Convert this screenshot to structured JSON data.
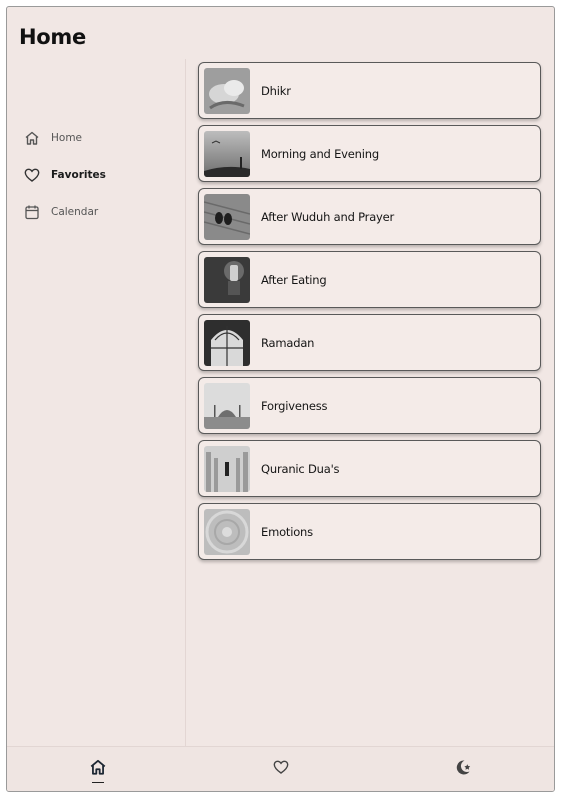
{
  "header": {
    "title": "Home"
  },
  "sidebar": {
    "items": [
      {
        "label": "Home",
        "icon": "home-icon"
      },
      {
        "label": "Favorites",
        "icon": "heart-icon",
        "active": true
      },
      {
        "label": "Calendar",
        "icon": "calendar-icon"
      }
    ]
  },
  "categories": [
    {
      "label": "Dhikr",
      "image": "hands-image"
    },
    {
      "label": "Morning and Evening",
      "image": "sunset-mosque-image"
    },
    {
      "label": "After Wuduh and Prayer",
      "image": "prayer-mat-image"
    },
    {
      "label": "After Eating",
      "image": "lantern-image"
    },
    {
      "label": "Ramadan",
      "image": "arched-window-image"
    },
    {
      "label": "Forgiveness",
      "image": "mosque-skyline-image"
    },
    {
      "label": "Quranic Dua's",
      "image": "corridor-image"
    },
    {
      "label": "Emotions",
      "image": "dome-ceiling-image"
    }
  ],
  "bottom_nav": {
    "tabs": [
      {
        "icon": "home-icon",
        "active": true
      },
      {
        "icon": "heart-icon"
      },
      {
        "icon": "crescent-star-icon"
      }
    ]
  },
  "colors": {
    "background": "#f1e7e4",
    "card_border": "#595959",
    "text": "#1b1b1b"
  }
}
